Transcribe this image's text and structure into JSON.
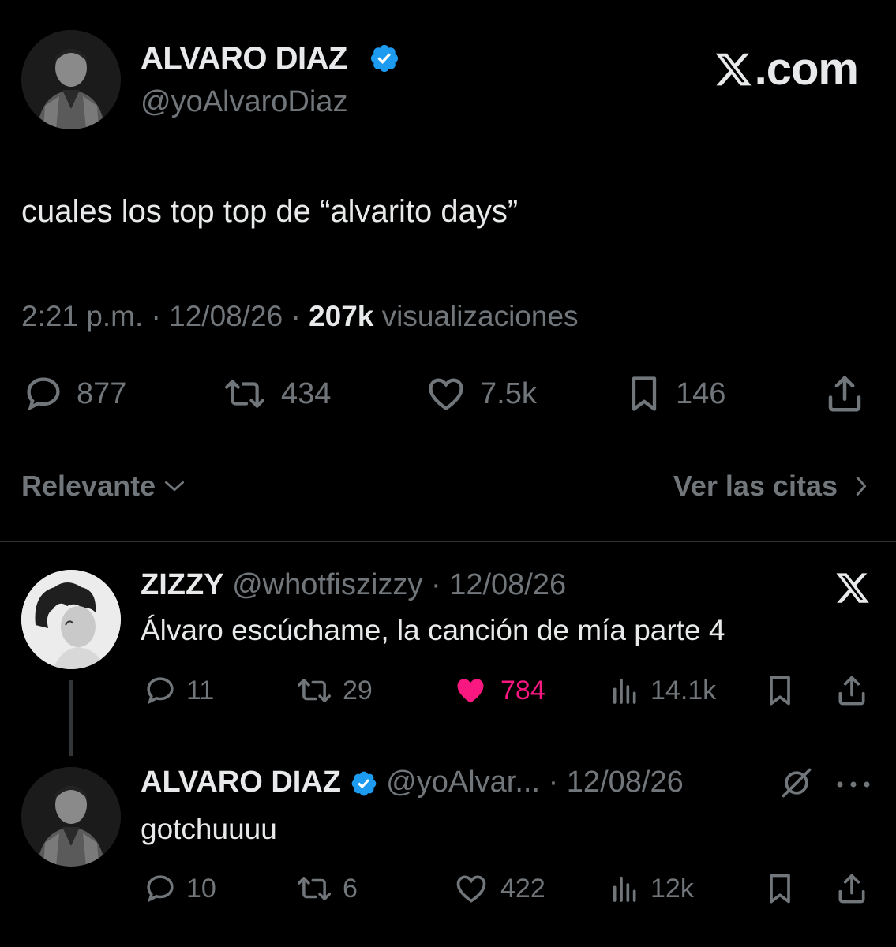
{
  "tweet": {
    "author_name": "ALVARO DIAZ",
    "author_handle": "@yoAlvaroDiaz",
    "brand": ".com",
    "text": "cuales los top top de “alvarito days”",
    "time": "2:21 p.m.",
    "date": "12/08/26",
    "views_count": "207k",
    "views_label": "visualizaciones",
    "stats": {
      "replies": "877",
      "reposts": "434",
      "likes": "7.5k",
      "bookmarks": "146"
    }
  },
  "sort": {
    "label": "Relevante",
    "quotes_link": "Ver las citas"
  },
  "replies": [
    {
      "name": "ZIZZY",
      "handle": "@whotfiszizzy",
      "date": "12/08/26",
      "text": "Álvaro escúchame, la canción de mía parte 4",
      "stats": {
        "replies": "11",
        "reposts": "29",
        "likes": "784",
        "views": "14.1k"
      },
      "liked": true
    },
    {
      "name": "ALVARO DIAZ",
      "handle": "@yoAlvar...",
      "date": "12/08/26",
      "text": "gotchuuuu",
      "stats": {
        "replies": "10",
        "reposts": "6",
        "likes": "422",
        "views": "12k"
      },
      "liked": false
    }
  ],
  "colors": {
    "background": "#000000",
    "text_primary": "#e7e9ea",
    "text_secondary": "#71767b",
    "verified": "#1d9bf0",
    "like_active": "#f91880",
    "divider": "#2f3336"
  },
  "icons": [
    "comment-icon",
    "repost-icon",
    "heart-icon",
    "bookmark-icon",
    "share-icon",
    "views-icon",
    "x-logo-icon",
    "verified-badge-icon",
    "grok-icon",
    "more-icon",
    "chevron-down-icon",
    "chevron-right-icon"
  ]
}
